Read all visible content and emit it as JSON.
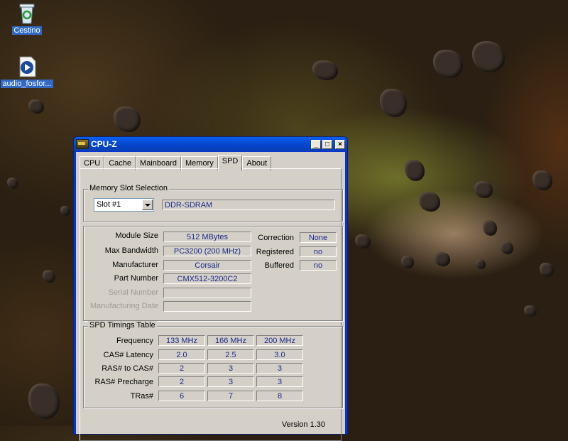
{
  "desktop": {
    "icons": [
      {
        "label": "Cestino"
      },
      {
        "label": "audio_fosfor..."
      }
    ]
  },
  "window": {
    "title": "CPU-Z",
    "controls": {
      "minimize": "_",
      "maximize": "□",
      "close": "×"
    },
    "tabs": [
      "CPU",
      "Cache",
      "Mainboard",
      "Memory",
      "SPD",
      "About"
    ],
    "active_tab": "SPD"
  },
  "slot_selection": {
    "title": "Memory Slot Selection",
    "selected_slot": "Slot #1",
    "memory_type": "DDR-SDRAM"
  },
  "module": {
    "labels": {
      "module_size": "Module Size",
      "max_bandwidth": "Max Bandwidth",
      "manufacturer": "Manufacturer",
      "part_number": "Part Number",
      "serial_number": "Serial Number",
      "manufacturing_date": "Manufacturing Date",
      "correction": "Correction",
      "registered": "Registered",
      "buffered": "Buffered"
    },
    "values": {
      "module_size": "512 MBytes",
      "max_bandwidth": "PC3200 (200 MHz)",
      "manufacturer": "Corsair",
      "part_number": "CMX512-3200C2",
      "serial_number": "",
      "manufacturing_date": "",
      "correction": "None",
      "registered": "no",
      "buffered": "no"
    }
  },
  "timings": {
    "title": "SPD Timings Table",
    "rows": [
      {
        "label": "Frequency",
        "values": [
          "133 MHz",
          "166 MHz",
          "200 MHz"
        ]
      },
      {
        "label": "CAS# Latency",
        "values": [
          "2.0",
          "2.5",
          "3.0"
        ]
      },
      {
        "label": "RAS# to CAS#",
        "values": [
          "2",
          "3",
          "3"
        ]
      },
      {
        "label": "RAS# Precharge",
        "values": [
          "2",
          "3",
          "3"
        ]
      },
      {
        "label": "TRas#",
        "values": [
          "6",
          "7",
          "8"
        ]
      }
    ]
  },
  "footer": {
    "version": "Version 1.30"
  }
}
